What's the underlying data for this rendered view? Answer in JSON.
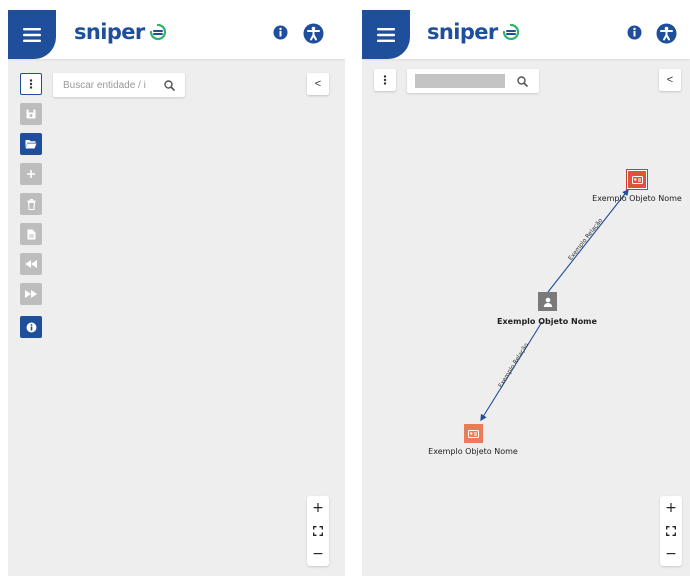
{
  "brand": {
    "logo_text": "sniper",
    "color": "#1f4e9a"
  },
  "left_panel": {
    "search": {
      "placeholder": "Buscar entidade / i",
      "value": ""
    },
    "collapse_label": "<",
    "toolbar": [
      {
        "id": "more",
        "icon": "vertical-dots-icon",
        "state": "outlined"
      },
      {
        "id": "save",
        "icon": "save-icon",
        "state": "disabled"
      },
      {
        "id": "open",
        "icon": "folder-open-icon",
        "state": "active"
      },
      {
        "id": "add",
        "icon": "plus-icon",
        "state": "disabled"
      },
      {
        "id": "delete",
        "icon": "trash-icon",
        "state": "disabled"
      },
      {
        "id": "export",
        "icon": "file-icon",
        "state": "disabled"
      },
      {
        "id": "back",
        "icon": "rewind-icon",
        "state": "disabled"
      },
      {
        "id": "forward",
        "icon": "fast-forward-icon",
        "state": "disabled"
      },
      {
        "id": "info",
        "icon": "info-icon",
        "state": "active"
      }
    ],
    "zoom": {
      "in": "+",
      "fit": "⛶",
      "out": "−"
    }
  },
  "right_panel": {
    "search": {
      "placeholder": "",
      "value": ""
    },
    "collapse_label": "<",
    "graph": {
      "nodes": [
        {
          "id": "n1",
          "label": "Exemplo Objeto Nome",
          "icon": "id-card-icon",
          "color": "#e0533a"
        },
        {
          "id": "n2",
          "label": "Exemplo Objeto Nome",
          "icon": "person-icon",
          "color": "#7a7a7a",
          "bold": true
        },
        {
          "id": "n3",
          "label": "Exemplo Objeto Nome",
          "icon": "id-card-icon",
          "color": "#ee7a5c"
        }
      ],
      "edges": [
        {
          "from": "n2",
          "to": "n1",
          "label": "Exemplo Relação"
        },
        {
          "from": "n2",
          "to": "n3",
          "label": "Exemplo Relação"
        }
      ]
    },
    "zoom": {
      "in": "+",
      "fit": "⛶",
      "out": "−"
    }
  }
}
